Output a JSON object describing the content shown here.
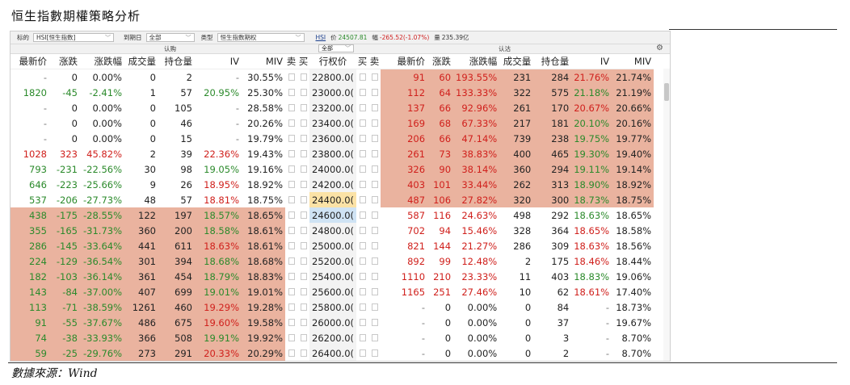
{
  "doc_title": "恒生指數期權策略分析",
  "source": "數據來源：Wind",
  "toolbar": {
    "underlying_label": "标的",
    "underlying_value": "HSI[恒生指数]",
    "expiry_label": "到期日",
    "expiry_value": "全部",
    "type_label": "类型",
    "type_value": "恒生指数期权",
    "code": "HSI",
    "price_label": "价",
    "price_value": "24507.81",
    "change_label": "幅",
    "change_value": "-265.52(-1.07%)",
    "volume_label": "量",
    "volume_value": "235.39亿"
  },
  "subbar": {
    "call_label": "认购",
    "put_label": "认沽",
    "filter_value": "全部"
  },
  "icons": {
    "gear": "gear-icon",
    "chevron": "chevron-down-icon"
  },
  "colors": {
    "up": "#d0201c",
    "down": "#2b8a2b",
    "in_the_money": "#eab39f",
    "atm_strike": "#fbe2a6",
    "selected_strike": "#cfe3f4"
  },
  "columns": {
    "call": [
      "最新价",
      "涨跌",
      "涨跌幅",
      "成交量",
      "持仓量",
      "IV",
      "MIV",
      "卖",
      "买"
    ],
    "strike": "行权价",
    "put": [
      "买",
      "卖",
      "最新价",
      "涨跌",
      "涨跌幅",
      "成交量",
      "持仓量",
      "IV",
      "MIV"
    ]
  },
  "rows": [
    {
      "strike": "22800.0(",
      "call": [
        "-",
        "0",
        "0.00%",
        "0",
        "2",
        "-",
        "30.55%"
      ],
      "put": [
        "91",
        "60",
        "193.55%",
        "231",
        "284",
        "21.76%",
        "21.74%"
      ],
      "call_itm": false,
      "put_itm": true
    },
    {
      "strike": "23000.0(",
      "call": [
        "1820",
        "-45",
        "-2.41%",
        "1",
        "57",
        "20.95%",
        "25.30%"
      ],
      "put": [
        "112",
        "64",
        "133.33%",
        "322",
        "575",
        "21.18%",
        "21.19%"
      ],
      "call_itm": false,
      "put_itm": true
    },
    {
      "strike": "23200.0(",
      "call": [
        "-",
        "0",
        "0.00%",
        "0",
        "105",
        "-",
        "28.58%"
      ],
      "put": [
        "137",
        "66",
        "92.96%",
        "261",
        "170",
        "20.67%",
        "20.66%"
      ],
      "call_itm": false,
      "put_itm": true
    },
    {
      "strike": "23400.0(",
      "call": [
        "-",
        "0",
        "0.00%",
        "0",
        "46",
        "-",
        "20.26%"
      ],
      "put": [
        "169",
        "68",
        "67.33%",
        "217",
        "181",
        "20.10%",
        "20.16%"
      ],
      "call_itm": false,
      "put_itm": true
    },
    {
      "strike": "23600.0(",
      "call": [
        "-",
        "0",
        "0.00%",
        "0",
        "15",
        "-",
        "19.79%"
      ],
      "put": [
        "206",
        "66",
        "47.14%",
        "739",
        "238",
        "19.75%",
        "19.77%"
      ],
      "call_itm": false,
      "put_itm": true
    },
    {
      "strike": "23800.0(",
      "call": [
        "1028",
        "323",
        "45.82%",
        "2",
        "39",
        "22.36%",
        "19.43%"
      ],
      "put": [
        "261",
        "73",
        "38.83%",
        "400",
        "465",
        "19.30%",
        "19.40%"
      ],
      "call_itm": false,
      "put_itm": true
    },
    {
      "strike": "24000.0(",
      "call": [
        "793",
        "-231",
        "-22.56%",
        "30",
        "98",
        "19.05%",
        "19.16%"
      ],
      "put": [
        "326",
        "90",
        "38.14%",
        "360",
        "294",
        "19.11%",
        "19.14%"
      ],
      "call_itm": false,
      "put_itm": true
    },
    {
      "strike": "24200.0(",
      "call": [
        "646",
        "-223",
        "-25.66%",
        "9",
        "26",
        "18.95%",
        "18.92%"
      ],
      "put": [
        "403",
        "101",
        "33.44%",
        "262",
        "313",
        "18.90%",
        "18.92%"
      ],
      "call_itm": false,
      "put_itm": true
    },
    {
      "strike": "24400.0(",
      "call": [
        "537",
        "-206",
        "-27.73%",
        "48",
        "57",
        "18.81%",
        "18.75%"
      ],
      "put": [
        "487",
        "106",
        "27.82%",
        "320",
        "300",
        "18.73%",
        "18.75%"
      ],
      "call_itm": false,
      "put_itm": true,
      "strike_hl": "atm"
    },
    {
      "strike": "24600.0(",
      "call": [
        "438",
        "-175",
        "-28.55%",
        "122",
        "197",
        "18.57%",
        "18.65%"
      ],
      "put": [
        "587",
        "116",
        "24.63%",
        "498",
        "292",
        "18.63%",
        "18.65%"
      ],
      "call_itm": true,
      "put_itm": false,
      "strike_hl": "sel"
    },
    {
      "strike": "24800.0(",
      "call": [
        "355",
        "-165",
        "-31.73%",
        "360",
        "200",
        "18.58%",
        "18.61%"
      ],
      "put": [
        "702",
        "94",
        "15.46%",
        "328",
        "364",
        "18.65%",
        "18.58%"
      ],
      "call_itm": true,
      "put_itm": false
    },
    {
      "strike": "25000.0(",
      "call": [
        "286",
        "-145",
        "-33.64%",
        "441",
        "611",
        "18.63%",
        "18.61%"
      ],
      "put": [
        "821",
        "144",
        "21.27%",
        "286",
        "309",
        "18.63%",
        "18.56%"
      ],
      "call_itm": true,
      "put_itm": false
    },
    {
      "strike": "25200.0(",
      "call": [
        "224",
        "-129",
        "-36.54%",
        "301",
        "394",
        "18.68%",
        "18.68%"
      ],
      "put": [
        "892",
        "99",
        "12.48%",
        "2",
        "175",
        "18.46%",
        "18.44%"
      ],
      "call_itm": true,
      "put_itm": false
    },
    {
      "strike": "25400.0(",
      "call": [
        "182",
        "-103",
        "-36.14%",
        "361",
        "454",
        "18.79%",
        "18.83%"
      ],
      "put": [
        "1110",
        "210",
        "23.33%",
        "11",
        "403",
        "18.83%",
        "19.06%"
      ],
      "call_itm": true,
      "put_itm": false
    },
    {
      "strike": "25600.0(",
      "call": [
        "143",
        "-84",
        "-37.00%",
        "407",
        "699",
        "19.01%",
        "19.01%"
      ],
      "put": [
        "1165",
        "251",
        "27.46%",
        "10",
        "62",
        "18.61%",
        "17.40%"
      ],
      "call_itm": true,
      "put_itm": false
    },
    {
      "strike": "25800.0(",
      "call": [
        "113",
        "-71",
        "-38.59%",
        "1261",
        "460",
        "19.29%",
        "19.28%"
      ],
      "put": [
        "-",
        "0",
        "0.00%",
        "0",
        "84",
        "-",
        "18.73%"
      ],
      "call_itm": true,
      "put_itm": false
    },
    {
      "strike": "26000.0(",
      "call": [
        "91",
        "-55",
        "-37.67%",
        "486",
        "675",
        "19.60%",
        "19.58%"
      ],
      "put": [
        "-",
        "0",
        "0.00%",
        "0",
        "37",
        "-",
        "19.67%"
      ],
      "call_itm": true,
      "put_itm": false
    },
    {
      "strike": "26200.0(",
      "call": [
        "74",
        "-38",
        "-33.93%",
        "366",
        "508",
        "19.91%",
        "19.92%"
      ],
      "put": [
        "-",
        "0",
        "0.00%",
        "0",
        "3",
        "-",
        "8.70%"
      ],
      "call_itm": true,
      "put_itm": false
    },
    {
      "strike": "26400.0(",
      "call": [
        "59",
        "-25",
        "-29.76%",
        "273",
        "291",
        "20.33%",
        "20.29%"
      ],
      "put": [
        "-",
        "0",
        "0.00%",
        "0",
        "2",
        "-",
        "8.70%"
      ],
      "call_itm": true,
      "put_itm": false
    }
  ]
}
